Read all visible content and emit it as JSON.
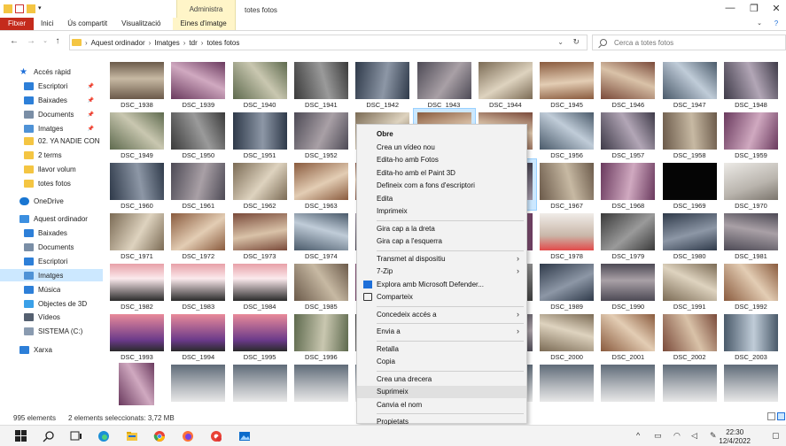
{
  "window": {
    "title": "totes fotos",
    "manage_label": "Administra",
    "tabs": [
      "Fitxer",
      "Inici",
      "Ús compartit",
      "Visualització",
      "Eines d'imatge"
    ],
    "controls": [
      "—",
      "❐",
      "✕"
    ]
  },
  "address": {
    "crumbs": [
      "Aquest ordinador",
      "Imatges",
      "tdr",
      "totes fotos"
    ],
    "search_placeholder": "Cerca a totes fotos"
  },
  "nav": {
    "items": [
      {
        "label": "Accés ràpid",
        "icon": "star-icon",
        "color": "#1e6fd9",
        "pin": false,
        "indent": 0
      },
      {
        "label": "Escriptori",
        "icon": "desktop-icon",
        "color": "#2d7fd8",
        "pin": true,
        "indent": 1
      },
      {
        "label": "Baixades",
        "icon": "download-icon",
        "color": "#2d7fd8",
        "pin": true,
        "indent": 1
      },
      {
        "label": "Documents",
        "icon": "documents-icon",
        "color": "#7a8ea6",
        "pin": true,
        "indent": 1
      },
      {
        "label": "Imatges",
        "icon": "pictures-icon",
        "color": "#4f92d6",
        "pin": true,
        "indent": 1
      },
      {
        "label": "02. YA NADIE CONC",
        "icon": "folder-icon",
        "color": "#f4c542",
        "pin": false,
        "indent": 1
      },
      {
        "label": "2 terms",
        "icon": "folder-icon",
        "color": "#f4c542",
        "pin": false,
        "indent": 1
      },
      {
        "label": "llavor volum",
        "icon": "folder-icon",
        "color": "#f4c542",
        "pin": false,
        "indent": 1
      },
      {
        "label": "totes fotos",
        "icon": "folder-icon",
        "color": "#f4c542",
        "pin": false,
        "indent": 1
      },
      {
        "label": "OneDrive",
        "icon": "cloud-icon",
        "color": "#1976d2",
        "pin": false,
        "indent": 0
      },
      {
        "label": "Aquest ordinador",
        "icon": "computer-icon",
        "color": "#3c8fe0",
        "pin": false,
        "indent": 0
      },
      {
        "label": "Baixades",
        "icon": "download-icon",
        "color": "#2d7fd8",
        "pin": false,
        "indent": 1
      },
      {
        "label": "Documents",
        "icon": "documents-icon",
        "color": "#7a8ea6",
        "pin": false,
        "indent": 1
      },
      {
        "label": "Escriptori",
        "icon": "desktop-icon",
        "color": "#2d7fd8",
        "pin": false,
        "indent": 1
      },
      {
        "label": "Imatges",
        "icon": "pictures-icon",
        "color": "#4f92d6",
        "pin": false,
        "indent": 1
      },
      {
        "label": "Música",
        "icon": "music-icon",
        "color": "#2d7fd8",
        "pin": false,
        "indent": 1
      },
      {
        "label": "Objectes de 3D",
        "icon": "cube-icon",
        "color": "#3aa0e8",
        "pin": false,
        "indent": 1
      },
      {
        "label": "Vídeos",
        "icon": "video-icon",
        "color": "#556070",
        "pin": false,
        "indent": 1
      },
      {
        "label": "SISTEMA (C:)",
        "icon": "drive-icon",
        "color": "#8a9bb0",
        "pin": false,
        "indent": 1
      },
      {
        "label": "Xarxa",
        "icon": "network-icon",
        "color": "#2d7fd8",
        "pin": false,
        "indent": 0
      }
    ],
    "selected_index": 14
  },
  "files": {
    "rows": [
      [
        "DSC_1938",
        "DSC_1939",
        "DSC_1940",
        "DSC_1941",
        "DSC_1942",
        "DSC_1943",
        "DSC_1944",
        "DSC_1945",
        "DSC_1946",
        "DSC_1947",
        "DSC_1948"
      ],
      [
        "DSC_1949",
        "DSC_1950",
        "DSC_1951",
        "DSC_1952",
        "",
        "",
        "",
        "DSC_1956",
        "DSC_1957",
        "DSC_1958",
        "DSC_1959"
      ],
      [
        "DSC_1960",
        "DSC_1961",
        "DSC_1962",
        "DSC_1963",
        "",
        "",
        "",
        "DSC_1967",
        "DSC_1968",
        "DSC_1969",
        "DSC_1970"
      ],
      [
        "DSC_1971",
        "DSC_1972",
        "DSC_1973",
        "DSC_1974",
        "",
        "",
        "",
        "DSC_1978",
        "DSC_1979",
        "DSC_1980",
        "DSC_1981"
      ],
      [
        "DSC_1982",
        "DSC_1983",
        "DSC_1984",
        "DSC_1985",
        "",
        "",
        "",
        "DSC_1989",
        "DSC_1990",
        "DSC_1991",
        "DSC_1992"
      ],
      [
        "DSC_1993",
        "DSC_1994",
        "DSC_1995",
        "DSC_1996",
        "",
        "",
        "",
        "DSC_2000",
        "DSC_2001",
        "DSC_2002",
        "DSC_2003"
      ],
      [
        "",
        "",
        "",
        "",
        "",
        "",
        "",
        "",
        "",
        "",
        ""
      ]
    ],
    "selected": [
      [
        1,
        5
      ],
      [
        2,
        6
      ]
    ]
  },
  "context_menu": {
    "items": [
      {
        "label": "Obre",
        "bold": true,
        "arrow": false,
        "icon": ""
      },
      {
        "label": "Crea un vídeo nou",
        "bold": false,
        "arrow": false,
        "icon": ""
      },
      {
        "label": "Edita-ho amb Fotos",
        "bold": false,
        "arrow": false,
        "icon": ""
      },
      {
        "label": "Edita-ho amb el Paint 3D",
        "bold": false,
        "arrow": false,
        "icon": ""
      },
      {
        "label": "Defineix com a fons d'escriptori",
        "bold": false,
        "arrow": false,
        "icon": ""
      },
      {
        "label": "Edita",
        "bold": false,
        "arrow": false,
        "icon": ""
      },
      {
        "label": "Imprimeix",
        "bold": false,
        "arrow": false,
        "icon": ""
      },
      {
        "sep": true
      },
      {
        "label": "Gira cap a la dreta",
        "bold": false,
        "arrow": false,
        "icon": ""
      },
      {
        "label": "Gira cap a l'esquerra",
        "bold": false,
        "arrow": false,
        "icon": ""
      },
      {
        "sep": true
      },
      {
        "label": "Transmet al dispositiu",
        "bold": false,
        "arrow": true,
        "icon": ""
      },
      {
        "label": "7-Zip",
        "bold": false,
        "arrow": true,
        "icon": ""
      },
      {
        "label": "Explora amb Microsoft Defender...",
        "bold": false,
        "arrow": false,
        "icon": "defender-icon"
      },
      {
        "label": "Comparteix",
        "bold": false,
        "arrow": false,
        "icon": "share-icon"
      },
      {
        "sep": true
      },
      {
        "label": "Concedeix accés a",
        "bold": false,
        "arrow": true,
        "icon": ""
      },
      {
        "sep": true
      },
      {
        "label": "Envia a",
        "bold": false,
        "arrow": true,
        "icon": ""
      },
      {
        "sep": true
      },
      {
        "label": "Retalla",
        "bold": false,
        "arrow": false,
        "icon": ""
      },
      {
        "label": "Copia",
        "bold": false,
        "arrow": false,
        "icon": ""
      },
      {
        "sep": true
      },
      {
        "label": "Crea una drecera",
        "bold": false,
        "arrow": false,
        "icon": ""
      },
      {
        "label": "Suprimeix",
        "bold": false,
        "arrow": false,
        "icon": "",
        "hover": true
      },
      {
        "label": "Canvia el nom",
        "bold": false,
        "arrow": false,
        "icon": ""
      },
      {
        "sep": true
      },
      {
        "label": "Propietats",
        "bold": false,
        "arrow": false,
        "icon": ""
      }
    ]
  },
  "status": {
    "count": "995 elements",
    "selection": "2 elements seleccionats: 3,72 MB"
  },
  "taskbar": {
    "time": "22:30",
    "date": "12/4/2022",
    "tray_chevron": "^"
  },
  "colors": {
    "file_tab": "#c42b1c",
    "selection": "#cce8ff",
    "manage": "#fff5c8"
  }
}
